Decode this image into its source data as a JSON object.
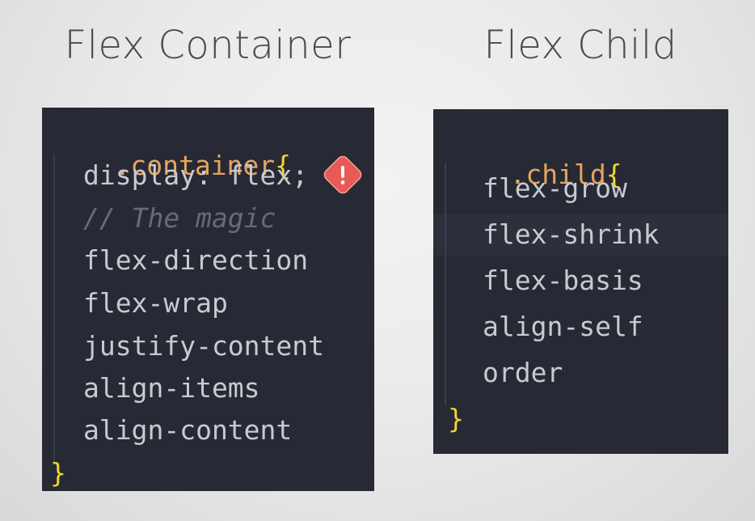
{
  "titles": {
    "left": "Flex Container",
    "right": "Flex Child"
  },
  "container": {
    "selector": ".container",
    "open_brace": "{",
    "close_brace": "}",
    "lines": [
      "display: flex;",
      "// The magic",
      "flex-direction",
      "flex-wrap",
      "justify-content",
      "align-items",
      "align-content"
    ],
    "warning_icon": "exclamation-diamond"
  },
  "child": {
    "selector": ".child",
    "open_brace": "{",
    "close_brace": "}",
    "lines": [
      "flex-grow",
      "flex-shrink",
      "flex-basis",
      "align-self",
      "order"
    ]
  },
  "colors": {
    "panel_bg": "#272934",
    "selector": "#e5a45e",
    "brace": "#f0d52f",
    "property": "#c7cad1",
    "comment": "#666b76",
    "warning": "#e85a56"
  }
}
